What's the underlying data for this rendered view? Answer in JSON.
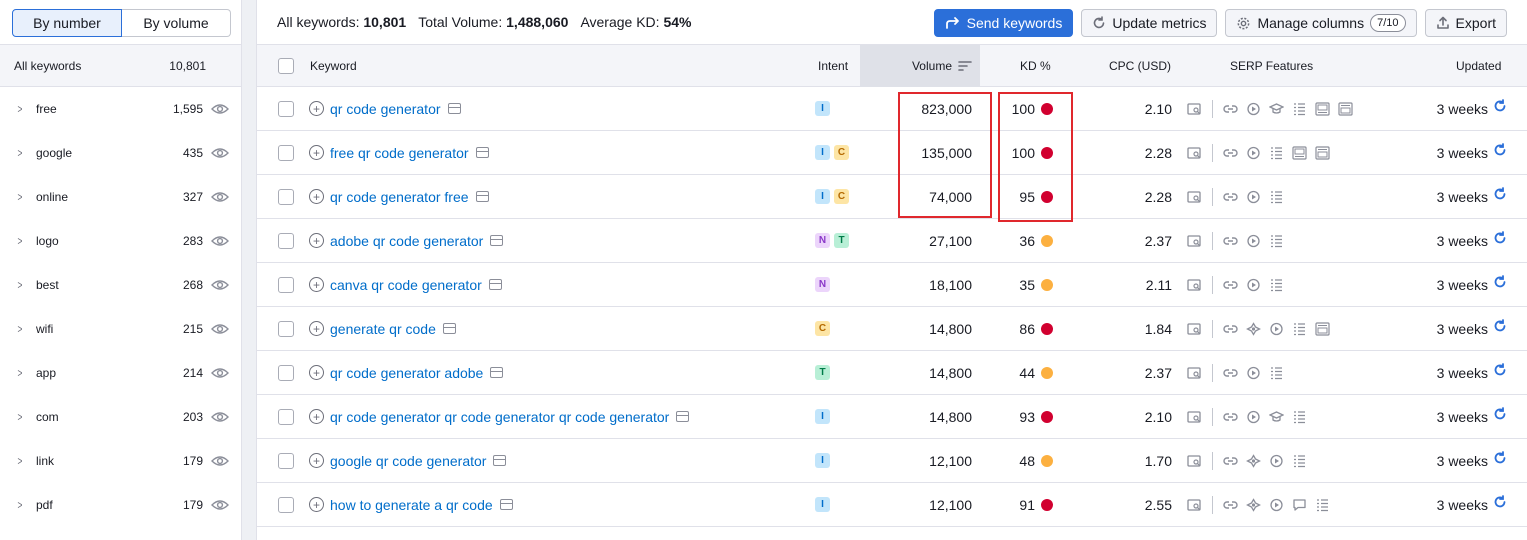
{
  "sidebar": {
    "toggle": [
      "By number",
      "By volume"
    ],
    "all_label": "All keywords",
    "all_count": "10,801",
    "groups": [
      {
        "label": "free",
        "count": "1,595"
      },
      {
        "label": "google",
        "count": "435"
      },
      {
        "label": "online",
        "count": "327"
      },
      {
        "label": "logo",
        "count": "283"
      },
      {
        "label": "best",
        "count": "268"
      },
      {
        "label": "wifi",
        "count": "215"
      },
      {
        "label": "app",
        "count": "214"
      },
      {
        "label": "com",
        "count": "203"
      },
      {
        "label": "link",
        "count": "179"
      },
      {
        "label": "pdf",
        "count": "179"
      }
    ]
  },
  "summary": {
    "all_label": "All keywords:",
    "all_value": "10,801",
    "volume_label": "Total Volume:",
    "volume_value": "1,488,060",
    "kd_label": "Average KD:",
    "kd_value": "54%"
  },
  "toolbar": {
    "send": "Send keywords",
    "update": "Update metrics",
    "manage": "Manage columns",
    "manage_badge": "7/10",
    "export": "Export"
  },
  "columns": {
    "keyword": "Keyword",
    "intent": "Intent",
    "volume": "Volume",
    "kd": "KD %",
    "cpc": "CPC (USD)",
    "serp": "SERP Features",
    "updated": "Updated"
  },
  "colors": {
    "hard": "#d1002f",
    "medium": "#fcb040",
    "accent": "#2b6fd9",
    "highlight": "#e0282d"
  },
  "rows": [
    {
      "keyword": "qr code generator",
      "intents": [
        "I"
      ],
      "volume": "823,000",
      "kd": "100",
      "kd_color": "#d1002f",
      "cpc": "2.10",
      "updated": "3 weeks",
      "serp": [
        "image-pack-icon",
        "sitelinks-icon",
        "video-icon",
        "knowledge-panel-icon",
        "people-also-ask-icon",
        "top-ads-icon",
        "bottom-ads-icon"
      ]
    },
    {
      "keyword": "free qr code generator",
      "intents": [
        "I",
        "C"
      ],
      "volume": "135,000",
      "kd": "100",
      "kd_color": "#d1002f",
      "cpc": "2.28",
      "updated": "3 weeks",
      "serp": [
        "image-pack-icon",
        "sitelinks-icon",
        "video-icon",
        "people-also-ask-icon",
        "top-ads-icon",
        "bottom-ads-icon"
      ]
    },
    {
      "keyword": "qr code generator free",
      "intents": [
        "I",
        "C"
      ],
      "volume": "74,000",
      "kd": "95",
      "kd_color": "#d1002f",
      "cpc": "2.28",
      "updated": "3 weeks",
      "serp": [
        "image-pack-icon",
        "sitelinks-icon",
        "video-icon",
        "people-also-ask-icon"
      ]
    },
    {
      "keyword": "adobe qr code generator",
      "intents": [
        "N",
        "T"
      ],
      "volume": "27,100",
      "kd": "36",
      "kd_color": "#fcb040",
      "cpc": "2.37",
      "updated": "3 weeks",
      "serp": [
        "image-pack-icon",
        "sitelinks-icon",
        "video-icon",
        "people-also-ask-icon"
      ]
    },
    {
      "keyword": "canva qr code generator",
      "intents": [
        "N"
      ],
      "volume": "18,100",
      "kd": "35",
      "kd_color": "#fcb040",
      "cpc": "2.11",
      "updated": "3 weeks",
      "serp": [
        "image-pack-icon",
        "sitelinks-icon",
        "video-icon",
        "people-also-ask-icon"
      ]
    },
    {
      "keyword": "generate qr code",
      "intents": [
        "C"
      ],
      "volume": "14,800",
      "kd": "86",
      "kd_color": "#d1002f",
      "cpc": "1.84",
      "updated": "3 weeks",
      "serp": [
        "image-pack-icon",
        "sitelinks-icon",
        "featured-snippet-icon",
        "video-icon",
        "people-also-ask-icon",
        "bottom-ads-icon"
      ]
    },
    {
      "keyword": "qr code generator adobe",
      "intents": [
        "T"
      ],
      "volume": "14,800",
      "kd": "44",
      "kd_color": "#fcb040",
      "cpc": "2.37",
      "updated": "3 weeks",
      "serp": [
        "image-pack-icon",
        "sitelinks-icon",
        "video-icon",
        "people-also-ask-icon"
      ]
    },
    {
      "keyword": "qr code generator qr code generator qr code generator",
      "intents": [
        "I"
      ],
      "volume": "14,800",
      "kd": "93",
      "kd_color": "#d1002f",
      "cpc": "2.10",
      "updated": "3 weeks",
      "serp": [
        "image-pack-icon",
        "sitelinks-icon",
        "video-icon",
        "knowledge-panel-icon",
        "people-also-ask-icon"
      ]
    },
    {
      "keyword": "google qr code generator",
      "intents": [
        "I"
      ],
      "volume": "12,100",
      "kd": "48",
      "kd_color": "#fcb040",
      "cpc": "1.70",
      "updated": "3 weeks",
      "serp": [
        "image-pack-icon",
        "sitelinks-icon",
        "featured-snippet-icon",
        "video-icon",
        "people-also-ask-icon"
      ]
    },
    {
      "keyword": "how to generate a qr code",
      "intents": [
        "I"
      ],
      "volume": "12,100",
      "kd": "91",
      "kd_color": "#d1002f",
      "cpc": "2.55",
      "updated": "3 weeks",
      "serp": [
        "image-pack-icon",
        "sitelinks-icon",
        "featured-snippet-icon",
        "video-icon",
        "reviews-icon",
        "people-also-ask-icon"
      ]
    }
  ]
}
